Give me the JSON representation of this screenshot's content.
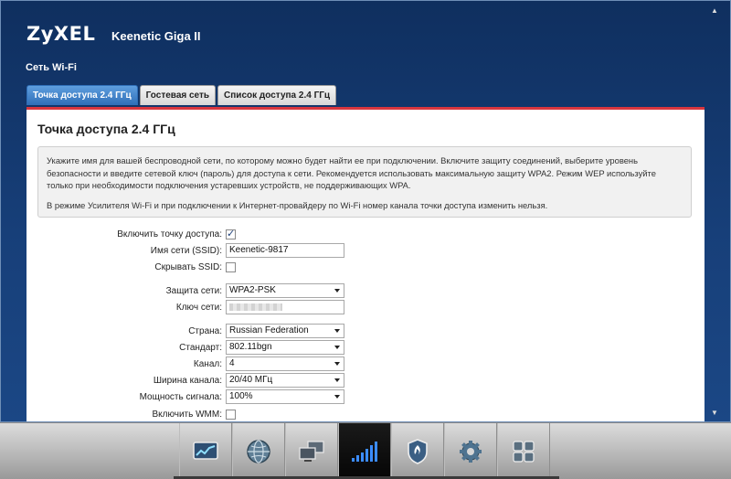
{
  "header": {
    "brand": "ZyXEL",
    "model": "Keenetic Giga II"
  },
  "page": {
    "title": "Сеть Wi-Fi"
  },
  "tabs": [
    {
      "label": "Точка доступа 2.4 ГГц",
      "active": true
    },
    {
      "label": "Гостевая сеть",
      "active": false
    },
    {
      "label": "Список доступа 2.4 ГГц",
      "active": false
    }
  ],
  "panel": {
    "title": "Точка доступа 2.4 ГГц",
    "info_p1": "Укажите имя для вашей беспроводной сети, по которому можно будет найти ее при подключении. Включите защиту соединений, выберите уровень безопасности и введите сетевой ключ (пароль) для доступа к сети. Рекомендуется использовать максимальную защиту WPA2. Режим WEP используйте только при необходимости подключения устаревших устройств, не поддерживающих WPA.",
    "info_p2": "В режиме Усилителя Wi-Fi и при подключении к Интернет-провайдеру по Wi-Fi номер канала точки доступа изменить нельзя."
  },
  "form": {
    "enable_ap": {
      "label": "Включить точку доступа:",
      "checked": true
    },
    "ssid": {
      "label": "Имя сети (SSID):",
      "value": "Keenetic-9817"
    },
    "hide_ssid": {
      "label": "Скрывать SSID:",
      "checked": false
    },
    "security": {
      "label": "Защита сети:",
      "value": "WPA2-PSK"
    },
    "key": {
      "label": "Ключ сети:"
    },
    "country": {
      "label": "Страна:",
      "value": "Russian Federation"
    },
    "standard": {
      "label": "Стандарт:",
      "value": "802.11bgn"
    },
    "channel": {
      "label": "Канал:",
      "value": "4"
    },
    "bandwidth": {
      "label": "Ширина канала:",
      "value": "20/40 МГц"
    },
    "power": {
      "label": "Мощность сигнала:",
      "value": "100%"
    },
    "wmm": {
      "label": "Включить WMM:",
      "checked": false
    }
  },
  "dock": {
    "items": [
      {
        "icon": "monitor-chart-icon",
        "active": false
      },
      {
        "icon": "globe-icon",
        "active": false
      },
      {
        "icon": "network-computers-icon",
        "active": false
      },
      {
        "icon": "wifi-signal-bars-icon",
        "active": true
      },
      {
        "icon": "shield-icon",
        "active": false
      },
      {
        "icon": "gear-icon",
        "active": false
      },
      {
        "icon": "apps-grid-icon",
        "active": false
      }
    ],
    "accent": "#2f6fb8",
    "panel_border": "#d9363e"
  }
}
